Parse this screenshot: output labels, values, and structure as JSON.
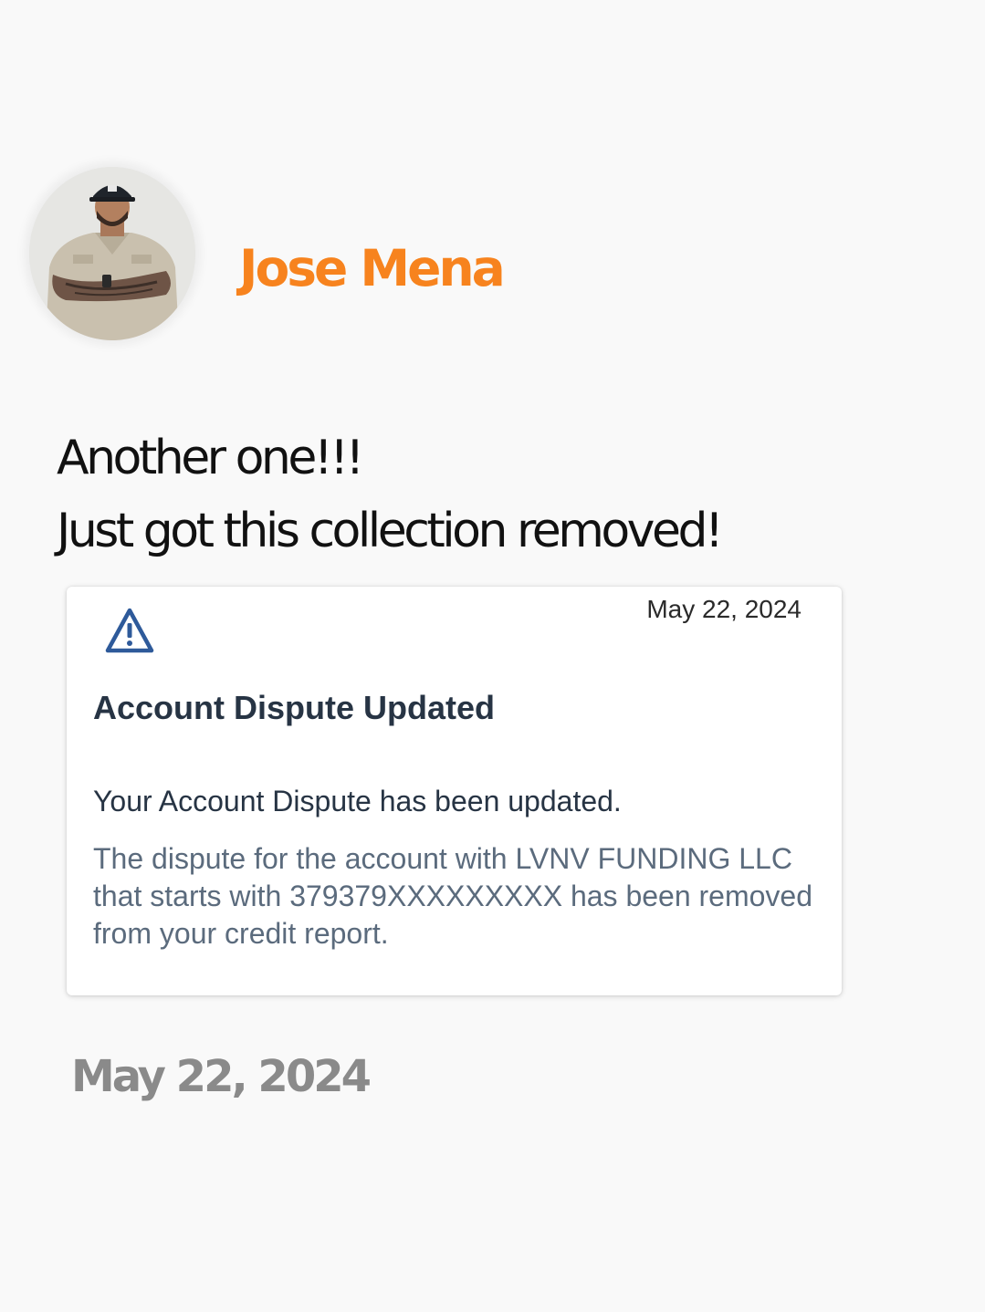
{
  "post": {
    "author_name": "Jose Mena",
    "headline_line1": "Another one!!!",
    "headline_line2": "Just got this collection removed!",
    "footer_date": "May 22, 2024"
  },
  "notification": {
    "date": "May 22, 2024",
    "icon": "warning-triangle-icon",
    "title": "Account Dispute Updated",
    "subtitle": "Your Account Dispute has been updated.",
    "body": "The dispute for the account with LVNV FUNDING LLC that starts with 379379XXXXXXXXX has been removed from your credit report."
  },
  "colors": {
    "name_accent": "#f7831e",
    "icon_blue": "#2e5a9a",
    "body_gray": "#5b6b7d",
    "title_dark": "#273444"
  }
}
